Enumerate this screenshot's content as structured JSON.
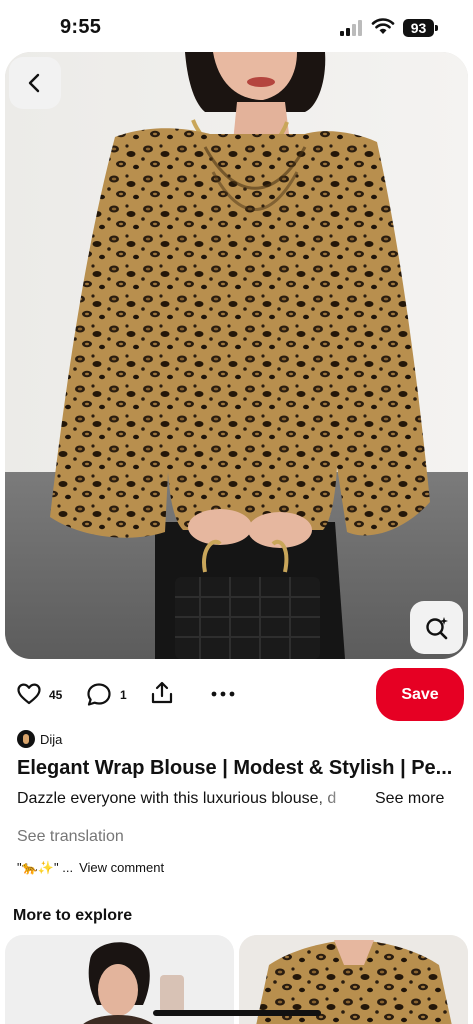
{
  "status_bar": {
    "time": "9:55",
    "battery": "93"
  },
  "pin": {
    "like_count": "45",
    "comment_count": "1",
    "save_label": "Save",
    "author": "Dija",
    "title": "Elegant Wrap Blouse | Modest & Stylish | Pe...",
    "description": "Dazzle everyone with this luxurious blouse, d",
    "see_more": "See more",
    "see_translation": "See translation",
    "comment_snippet": "\"🐆✨\" ...",
    "view_comment": "View comment"
  },
  "explore": {
    "heading": "More to explore"
  },
  "colors": {
    "save_button": "#e60023",
    "secondary_text": "#767676"
  },
  "icons": [
    "back-arrow-icon",
    "visual-search-icon",
    "heart-icon",
    "comment-icon",
    "share-icon",
    "more-dots-icon"
  ]
}
